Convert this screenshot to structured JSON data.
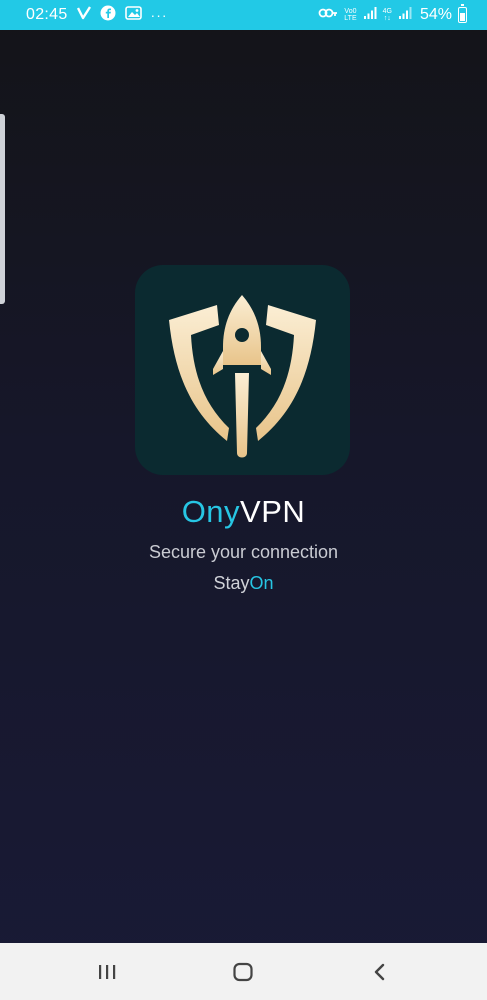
{
  "status_bar": {
    "time": "02:45",
    "battery": "54%",
    "battery_level": 0.54,
    "network_top": "Vo0",
    "network_bottom": "LTE",
    "network2_top": "4G",
    "network2_bottom": "↑↓",
    "notification_icons": [
      "vpn-v-icon",
      "facebook-icon",
      "gallery-icon",
      "more-dots-icon"
    ],
    "right_icons": [
      "key-icon",
      "signal-icon",
      "signal-icon-2",
      "battery-icon"
    ],
    "overflow": "···"
  },
  "app": {
    "name_accent": "Ony",
    "name_main": "VPN",
    "tagline": "Secure your connection",
    "slogan_main": "Stay",
    "slogan_accent": "On"
  },
  "colors": {
    "accent": "#27c6e4",
    "status_bar": "#22c9e6",
    "logo_bg": "#0b2a30",
    "logo_gold": "#f3dfb9"
  },
  "nav_bar": {
    "icons": [
      "recent-apps-icon",
      "home-icon",
      "back-icon"
    ]
  }
}
